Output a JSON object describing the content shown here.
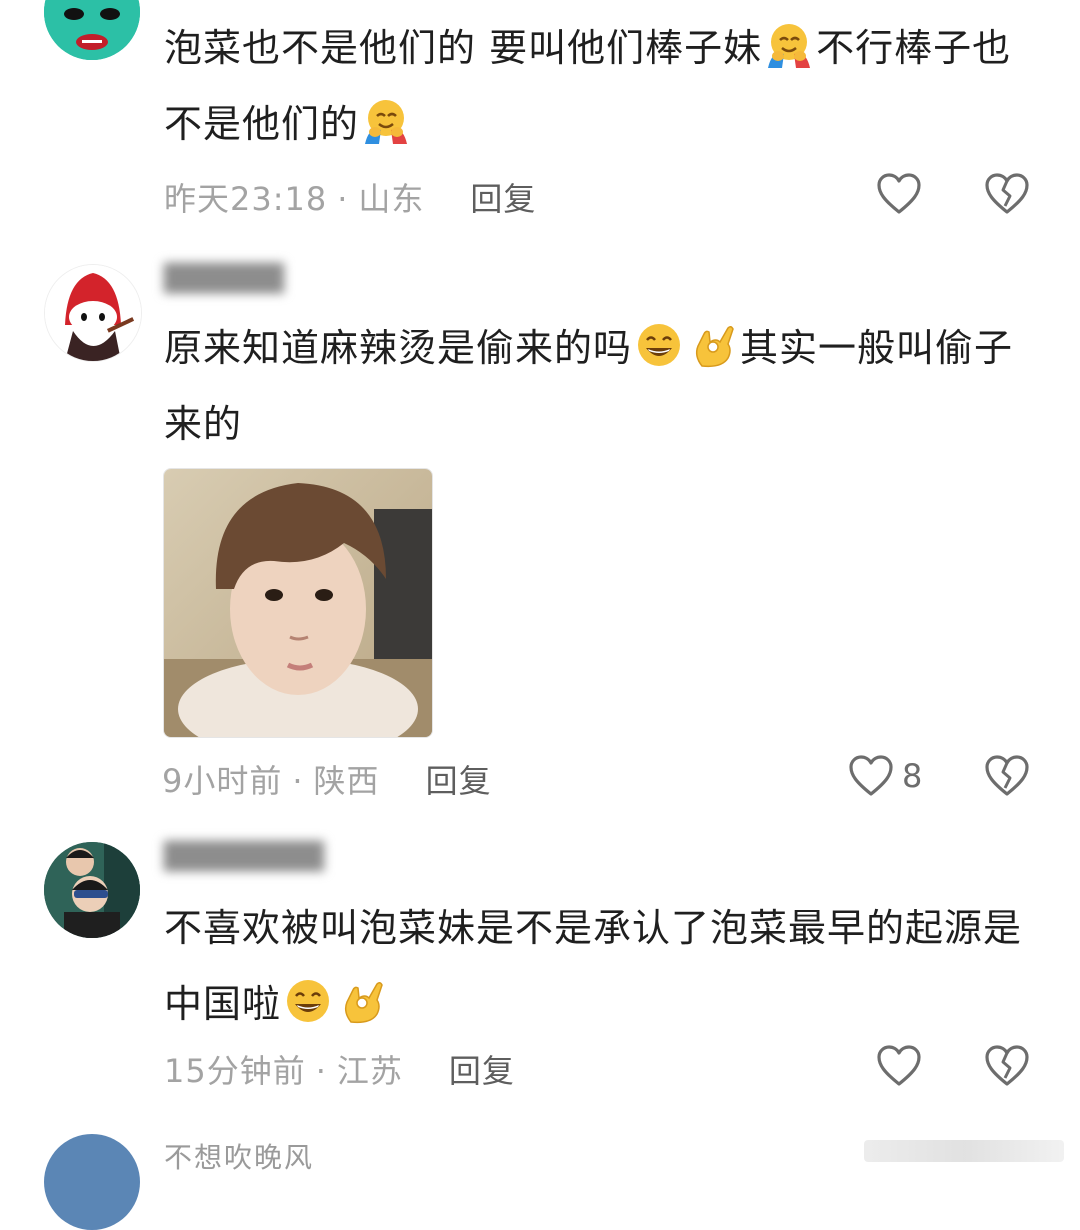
{
  "comments": [
    {
      "text_parts": [
        "泡菜也不是他们的 要叫他们棒子妹",
        "不行棒子也不是他们的",
        ""
      ],
      "time": "昨天23:18",
      "location": "山东",
      "reply_label": "回复",
      "likes": ""
    },
    {
      "text_parts": [
        "原来知道麻辣烫是偷来的吗",
        "",
        "其实一般叫偷子来的"
      ],
      "time": "9小时前",
      "location": "陕西",
      "reply_label": "回复",
      "likes": "8"
    },
    {
      "text_parts": [
        "不喜欢被叫泡菜妹是不是承认了泡菜最早的起源是中国啦",
        "",
        ""
      ],
      "time": "15分钟前",
      "location": "江苏",
      "reply_label": "回复",
      "likes": ""
    },
    {
      "username": "不想吹晚风"
    }
  ],
  "separator": "·",
  "colors": {
    "text": "#1f1f1f",
    "meta": "#a3a3a3",
    "reply": "#5e5e5e",
    "avatar1": "#27b8a0"
  },
  "icons": [
    "heart-icon",
    "broken-heart-icon",
    "hugging-face-emoji",
    "grinning-sweat-emoji",
    "ok-hand-emoji"
  ]
}
